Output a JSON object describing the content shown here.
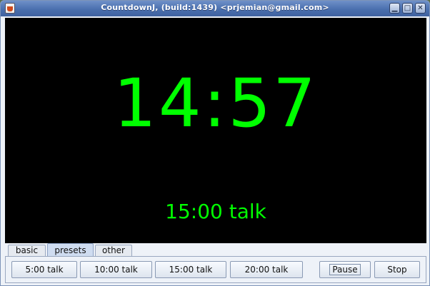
{
  "window": {
    "title": "CountdownJ, (build:1439) <prjemian@gmail.com>"
  },
  "controls": {
    "minimize": "▁",
    "maximize": "□",
    "close": "✕"
  },
  "display": {
    "time": "14:57",
    "label": "15:00 talk",
    "color": "#00ff00",
    "background": "#000000"
  },
  "tabs": [
    {
      "label": "basic",
      "selected": false
    },
    {
      "label": "presets",
      "selected": true
    },
    {
      "label": "other",
      "selected": false
    }
  ],
  "presets": [
    "5:00 talk",
    "10:00 talk",
    "15:00 talk",
    "20:00 talk"
  ],
  "actions": {
    "pause": "Pause",
    "stop": "Stop"
  }
}
